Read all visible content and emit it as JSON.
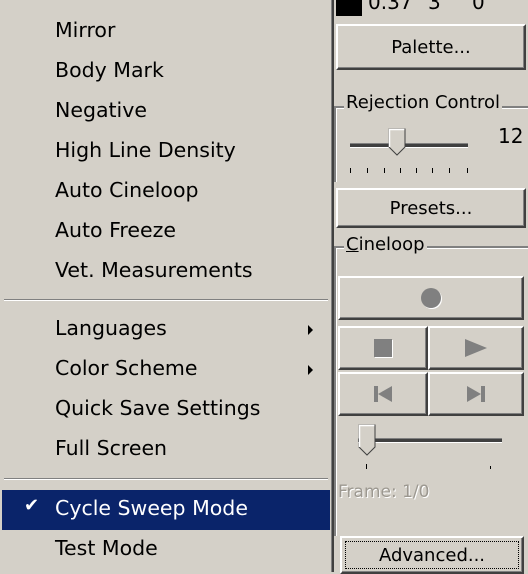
{
  "menu": {
    "groups": [
      {
        "items": [
          {
            "label": "Mirror",
            "checked": false,
            "submenu": false
          },
          {
            "label": "Body Mark",
            "checked": false,
            "submenu": false
          },
          {
            "label": "Negative",
            "checked": false,
            "submenu": false
          },
          {
            "label": "High Line Density",
            "checked": false,
            "submenu": false
          },
          {
            "label": "Auto Cineloop",
            "checked": false,
            "submenu": false
          },
          {
            "label": "Auto Freeze",
            "checked": false,
            "submenu": false
          },
          {
            "label": "Vet. Measurements",
            "checked": false,
            "submenu": false
          }
        ]
      },
      {
        "items": [
          {
            "label": "Languages",
            "checked": false,
            "submenu": true
          },
          {
            "label": "Color Scheme",
            "checked": false,
            "submenu": true
          },
          {
            "label": "Quick Save Settings",
            "checked": false,
            "submenu": false
          },
          {
            "label": "Full Screen",
            "checked": false,
            "submenu": false
          }
        ]
      },
      {
        "items": [
          {
            "label": "Cycle Sweep Mode",
            "checked": true,
            "submenu": false,
            "highlighted": true
          },
          {
            "label": "Test Mode",
            "checked": false,
            "submenu": false
          }
        ]
      }
    ],
    "check_glyph": "✔",
    "highlight_color": "#0a246a"
  },
  "panel": {
    "readout": [
      "0.37",
      "3",
      "0"
    ],
    "palette_button": "Palette...",
    "rejection": {
      "title_before": "Re",
      "title_accel": "j",
      "title_after": "ection Control",
      "value": "12"
    },
    "presets_button": "Presets...",
    "cineloop": {
      "title_accel": "C",
      "title_after": "ineloop",
      "record_icon": "record-icon",
      "stop_icon": "stop-icon",
      "play_icon": "play-icon",
      "skip_start_icon": "skip-to-start-icon",
      "skip_end_icon": "skip-to-end-icon",
      "frame_label": "Frame: 1/0"
    },
    "advanced_button": "Advanced..."
  }
}
